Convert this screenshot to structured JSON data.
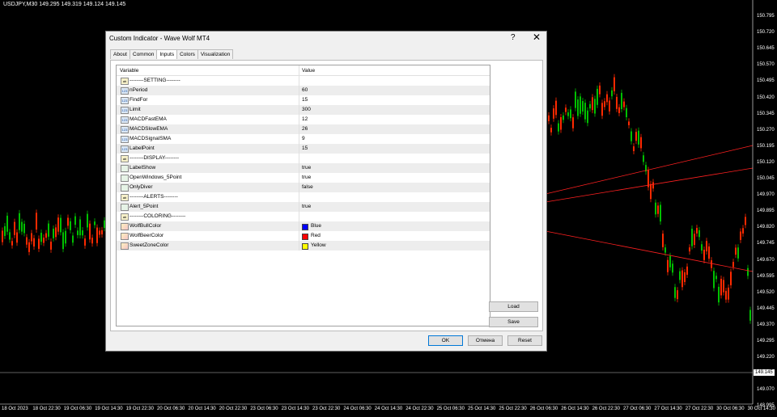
{
  "chart": {
    "title": "USDJPY,M30  149.295 149.319 149.124 149.145",
    "current_price": "149.145",
    "price_axis": [
      "150.795",
      "150.720",
      "150.645",
      "150.570",
      "150.495",
      "150.420",
      "150.345",
      "150.270",
      "150.195",
      "150.120",
      "150.045",
      "149.970",
      "149.895",
      "149.820",
      "149.745",
      "149.670",
      "149.595",
      "149.520",
      "149.445",
      "149.370",
      "149.295",
      "149.220",
      "149.145",
      "149.070",
      "148.995"
    ],
    "time_axis": [
      "18 Oct 2023",
      "18 Oct 22:30",
      "19 Oct 06:30",
      "19 Oct 14:30",
      "19 Oct 22:30",
      "20 Oct 06:30",
      "20 Oct 14:30",
      "20 Oct 22:30",
      "23 Oct 06:30",
      "23 Oct 14:30",
      "23 Oct 22:30",
      "24 Oct 06:30",
      "24 Oct 14:30",
      "24 Oct 22:30",
      "25 Oct 06:30",
      "25 Oct 14:30",
      "25 Oct 22:30",
      "26 Oct 06:30",
      "26 Oct 14:30",
      "26 Oct 22:30",
      "27 Oct 06:30",
      "27 Oct 14:30",
      "27 Oct 22:30",
      "30 Oct 06:30",
      "30 Oct 14:30"
    ],
    "colors": {
      "background": "#000000",
      "bull": "#00c000",
      "bear": "#ff2a00",
      "trendline": "#ff2020"
    }
  },
  "dialog": {
    "title": "Custom Indicator - Wave Wolf MT4",
    "help": "?",
    "close": "✕",
    "tabs": [
      "About",
      "Common",
      "Inputs",
      "Colors",
      "Visualization"
    ],
    "active_tab": "Inputs",
    "columns": [
      "Variable",
      "Value"
    ],
    "rows": [
      {
        "icon": "ab",
        "variable": "--------SETTING--------",
        "value": ""
      },
      {
        "icon": "123",
        "variable": "nPeriod",
        "value": "60"
      },
      {
        "icon": "123",
        "variable": "FindFor",
        "value": "15"
      },
      {
        "icon": "123",
        "variable": "Limit",
        "value": "300"
      },
      {
        "icon": "123",
        "variable": "MACDFastEMA",
        "value": "12"
      },
      {
        "icon": "123",
        "variable": "MACDSlowEMA",
        "value": "26"
      },
      {
        "icon": "123",
        "variable": "MACDSignalSMA",
        "value": "9"
      },
      {
        "icon": "123",
        "variable": "LabelPoint",
        "value": "15"
      },
      {
        "icon": "ab",
        "variable": "--------DISPLAY--------",
        "value": ""
      },
      {
        "icon": "bool",
        "variable": "LabelShow",
        "value": "true"
      },
      {
        "icon": "bool",
        "variable": "OpenWindows_5Point",
        "value": "true"
      },
      {
        "icon": "bool",
        "variable": "OnlyDiver",
        "value": "false"
      },
      {
        "icon": "ab",
        "variable": "--------ALERTS--------",
        "value": ""
      },
      {
        "icon": "bool",
        "variable": "Alert_5Point",
        "value": "true"
      },
      {
        "icon": "ab",
        "variable": "--------COLORING--------",
        "value": ""
      },
      {
        "icon": "color",
        "variable": "WolfBullColor",
        "value": "Blue",
        "swatch": "#0000ff"
      },
      {
        "icon": "color",
        "variable": "WolfBeerColor",
        "value": "Red",
        "swatch": "#ff0000"
      },
      {
        "icon": "color",
        "variable": "SweetZoneColor",
        "value": "Yellow",
        "swatch": "#ffff00"
      }
    ],
    "buttons": {
      "load": "Load",
      "save": "Save",
      "ok": "OK",
      "cancel": "Отмена",
      "reset": "Reset"
    }
  }
}
